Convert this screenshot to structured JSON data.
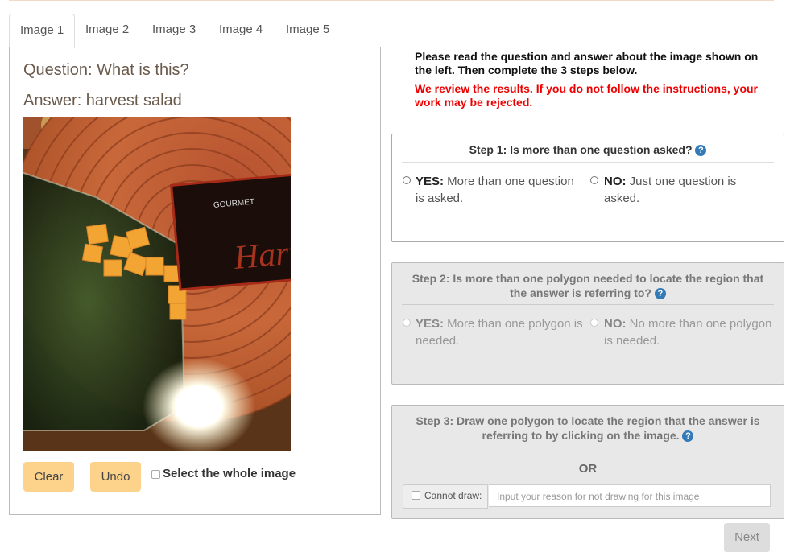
{
  "tabs": [
    "Image 1",
    "Image 2",
    "Image 3",
    "Image 4",
    "Image 5"
  ],
  "question": "Question: What is this?",
  "answer": "Answer: harvest salad",
  "photo": {
    "label_text": "Harvest Sa",
    "brand_text": "GOURMET"
  },
  "buttons": {
    "clear": "Clear",
    "undo": "Undo",
    "next": "Next"
  },
  "select_whole": "Select the whole image",
  "instructions": "Please read the question and answer about the image shown on the left. Then complete the 3 steps below.",
  "warning": "We review the results. If you do not follow the instructions, your work may be rejected.",
  "step1": {
    "title": "Step 1: Is more than one question asked?",
    "yes_bold": "YES:",
    "yes_text": " More than one question is asked.",
    "no_bold": "NO:",
    "no_text": " Just one question is asked."
  },
  "step2": {
    "title": "Step 2: Is more than one polygon needed to locate the region that the answer is referring to?",
    "yes_bold": "YES:",
    "yes_text": " More than one polygon is needed.",
    "no_bold": "NO:",
    "no_text": " No more than one polygon is needed."
  },
  "step3": {
    "title": "Step 3: Draw one polygon to locate the region that the answer is referring to by clicking on the image.",
    "or": "OR",
    "cannot_draw": "Cannot draw:",
    "reason_placeholder": "Input your reason for not drawing for this image"
  },
  "help_glyph": "?",
  "colors": {
    "button_yellow": "#fdd38c",
    "warning_red": "#ee0000",
    "help_blue": "#337ab7"
  }
}
